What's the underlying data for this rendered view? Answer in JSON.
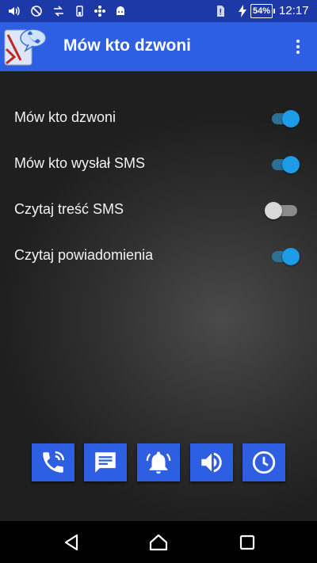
{
  "status_bar": {
    "icons": [
      "volume-icon",
      "sync-off-icon",
      "data-transfer-icon",
      "battery-saver-icon",
      "network-icon",
      "android-icon",
      "sim-alert-icon",
      "charging-icon"
    ],
    "battery": "54%",
    "time": "12:17"
  },
  "app_bar": {
    "title": "Mów kto dzwoni",
    "logo": "app-logo-icon",
    "menu_icon": "overflow-menu-icon"
  },
  "settings": [
    {
      "label": "Mów kto dzwoni",
      "enabled": true
    },
    {
      "label": "Mów kto wysłał SMS",
      "enabled": true
    },
    {
      "label": "Czytaj treść SMS",
      "enabled": false
    },
    {
      "label": "Czytaj powiadomienia",
      "enabled": true
    }
  ],
  "toolbar": {
    "buttons": [
      "phone-call-icon",
      "message-icon",
      "bell-icon",
      "speaker-icon",
      "clock-icon"
    ]
  },
  "nav_bar": {
    "buttons": [
      "back-icon",
      "home-icon",
      "recents-icon"
    ]
  },
  "colors": {
    "status_bar": "#1d39a8",
    "app_bar": "#2e5fe3",
    "switch_on": "#1d9be8",
    "switch_off": "#d8d8d8"
  }
}
